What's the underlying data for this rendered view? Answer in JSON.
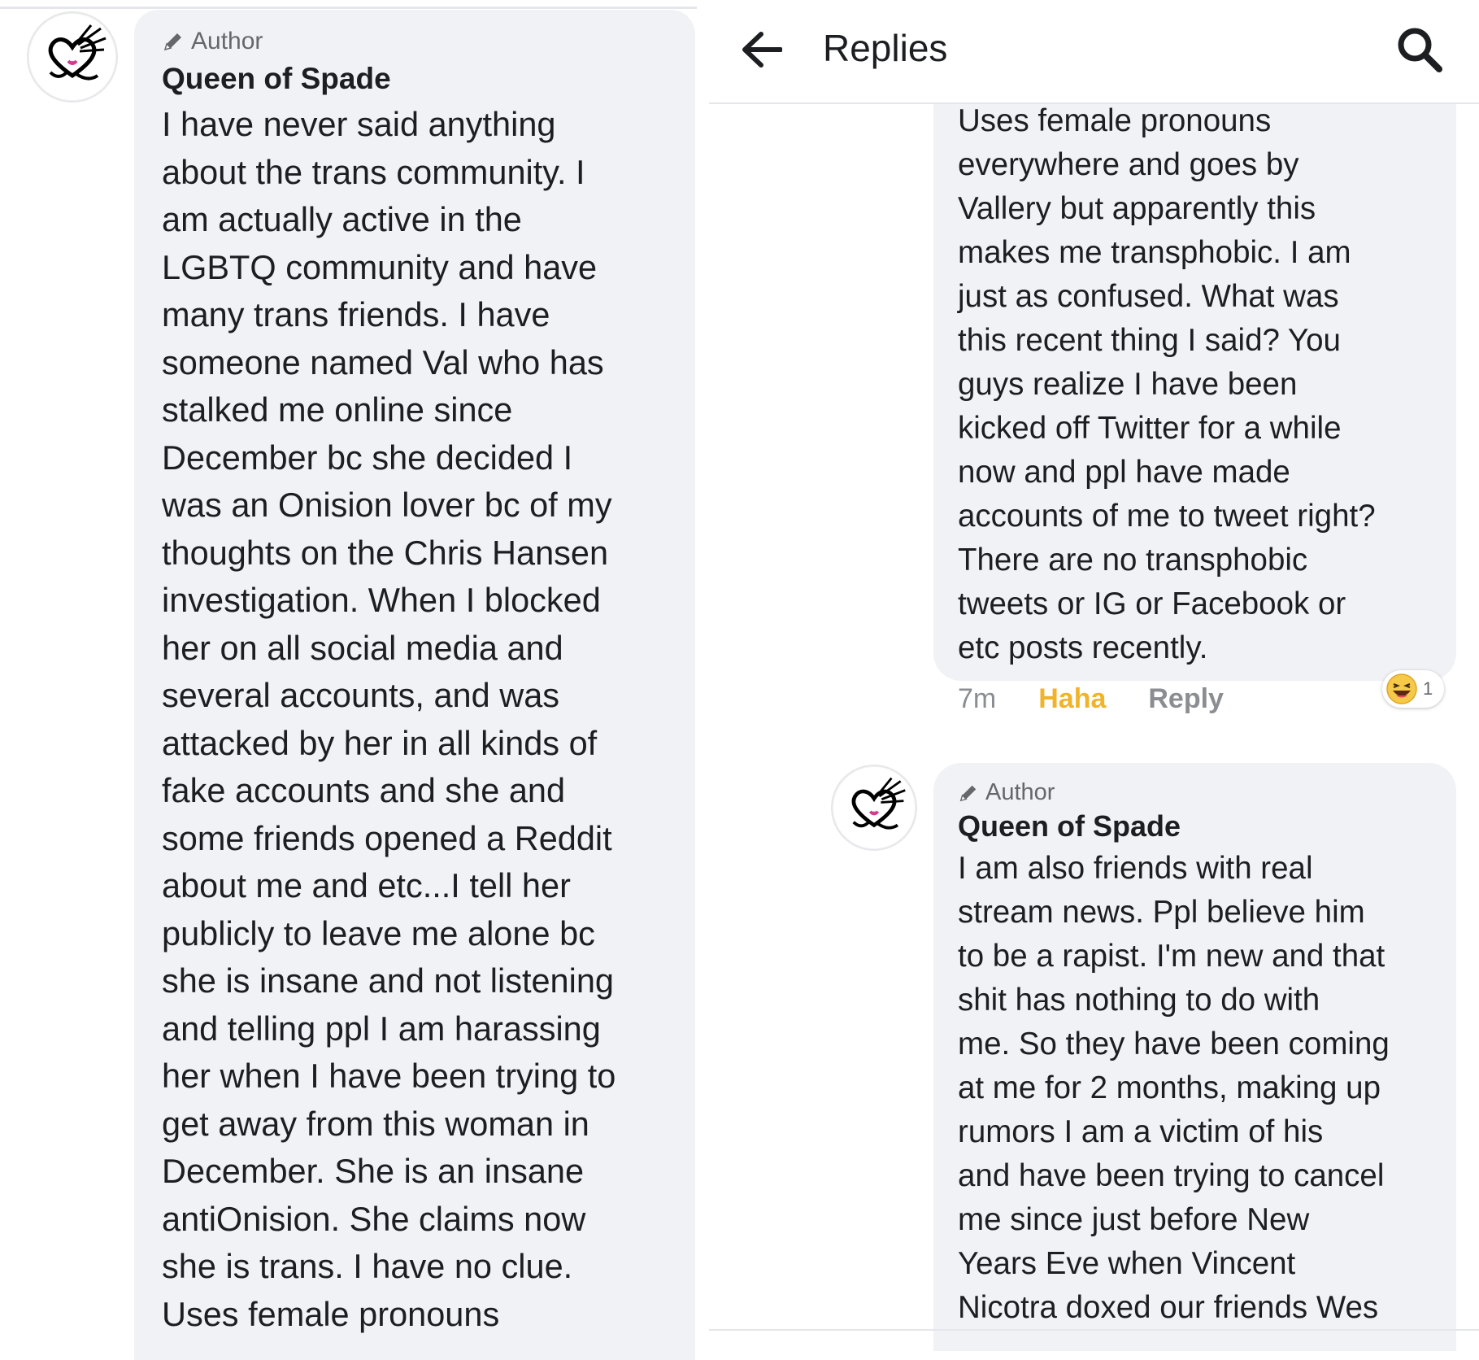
{
  "left_comment": {
    "author_badge": "Author",
    "author_name": "Queen of Spade",
    "text": "I have never said anything\nabout the trans community. I\nam actually active in the\nLGBTQ community and have\nmany trans friends. I have\nsomeone named Val who has\nstalked me online since\nDecember bc she decided I\nwas an Onision lover bc of my\nthoughts on the Chris Hansen\ninvestigation. When I blocked\nher on all social media and\nseveral accounts, and was\nattacked by her in all kinds of\nfake accounts and she and\nsome friends opened a Reddit\nabout me and etc...I tell her\npublicly to leave me alone bc\nshe is insane and not listening\nand telling ppl I am harassing\nher when I have been trying to\nget away from this woman in\nDecember. She is an insane\nantiOnision. She claims now\nshe is trans. I have no clue.\nUses female pronouns"
  },
  "right_header": {
    "title": "Replies",
    "back_icon": "arrow-left-icon",
    "search_icon": "search-icon"
  },
  "right_comment_1": {
    "text": "Uses female pronouns\neverywhere and goes by\nVallery but apparently this\nmakes me transphobic. I am\njust as confused. What was\nthis recent thing I said? You\nguys realize I have been\nkicked off Twitter for a while\nnow and ppl have made\naccounts of me to tweet right?\nThere are no transphobic\ntweets or IG or Facebook or\netc posts recently.",
    "time": "7m",
    "haha_label": "Haha",
    "reply_label": "Reply",
    "reaction_icon": "laughing-emoji-icon",
    "reaction_count": "1"
  },
  "right_comment_2": {
    "author_badge": "Author",
    "author_name": "Queen of Spade",
    "text": "I am also friends with real\nstream news. Ppl believe him\nto be a rapist. I'm new and that\nshit has nothing to do with\nme. So they have been coming\nat me for 2 months, making up\nrumors I am a victim of his\nand have been trying to cancel\nme since just before New\nYears Eve when Vincent\nNicotra doxed our friends Wes"
  },
  "colors": {
    "bubble": "#f0f2f5",
    "haha": "#f1b32a",
    "muted": "#65676b"
  }
}
